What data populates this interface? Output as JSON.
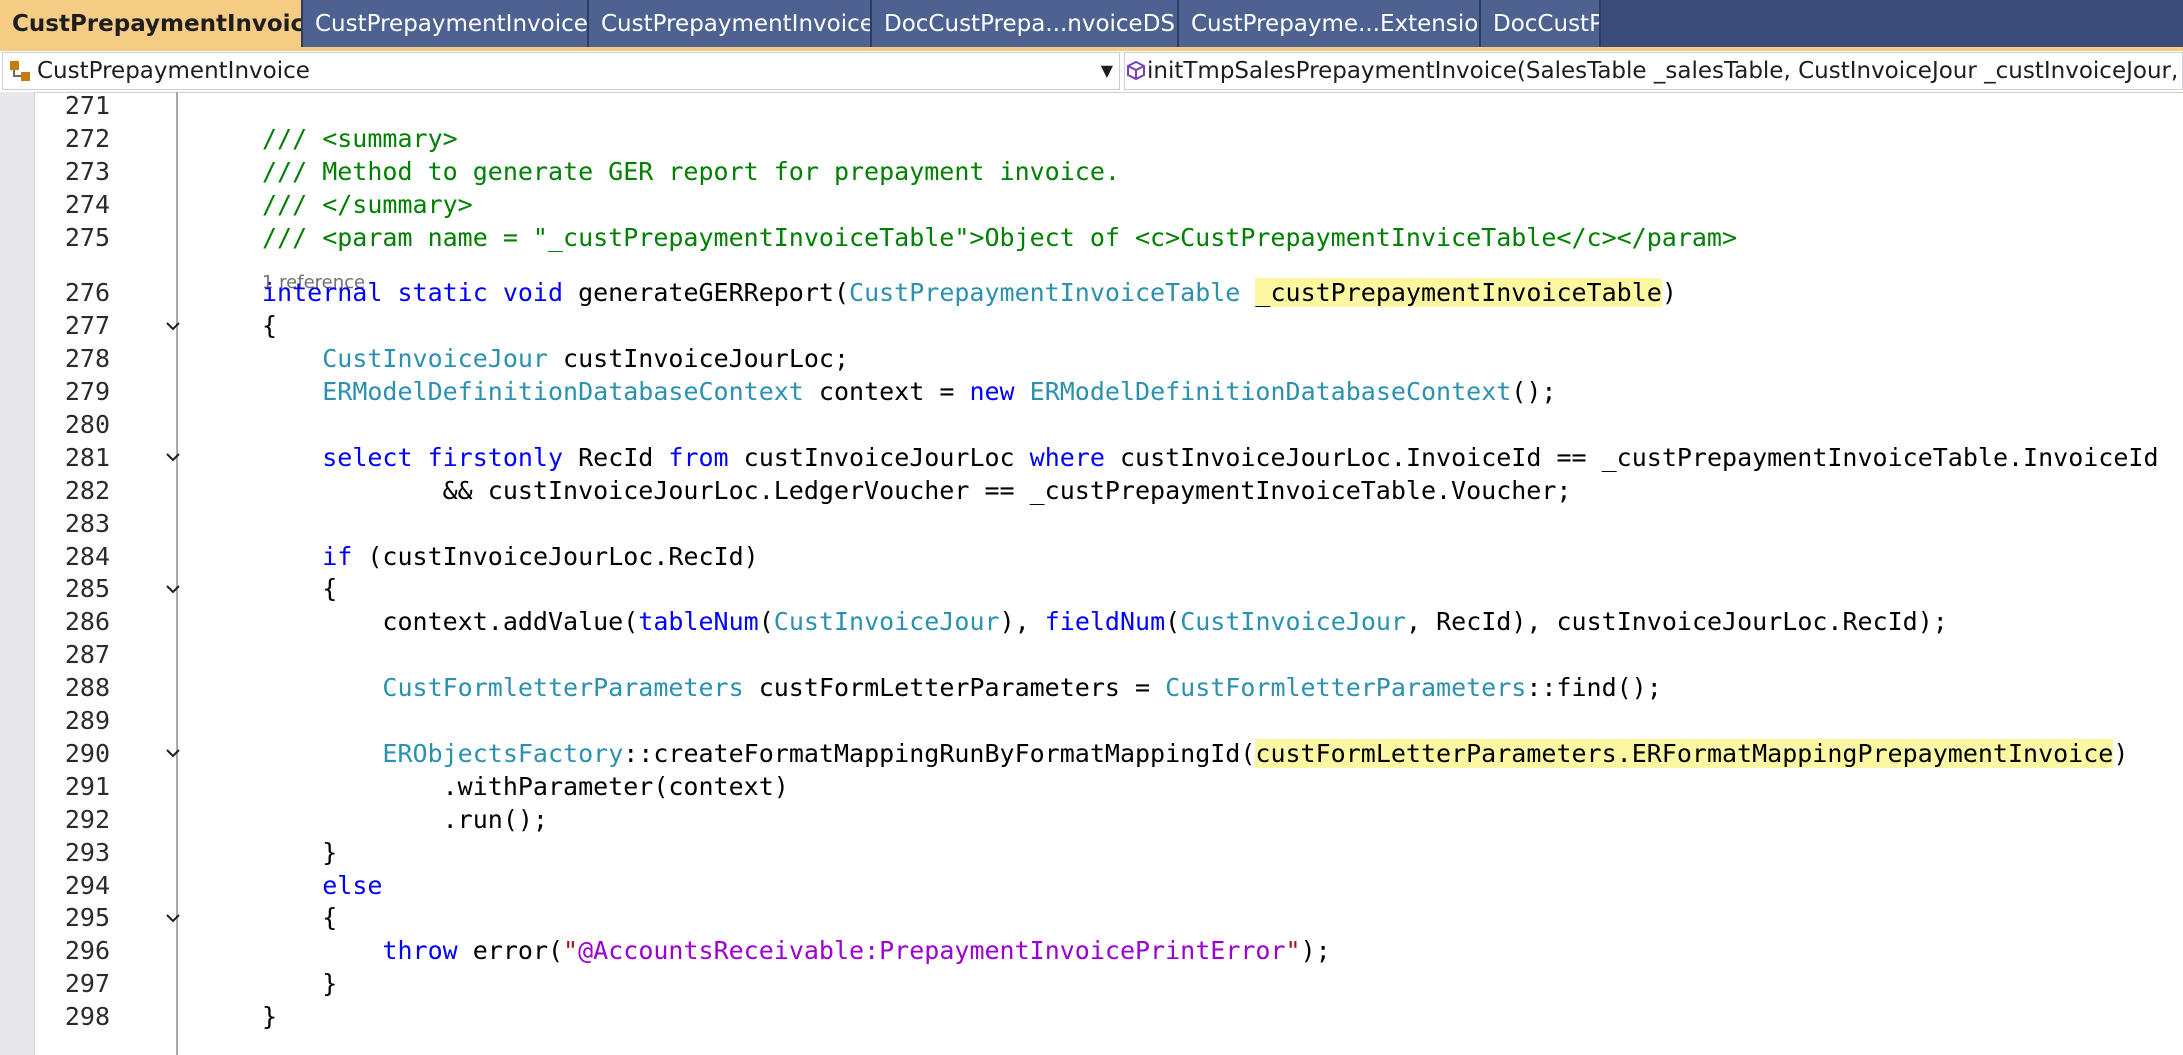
{
  "tabs": [
    {
      "label": "CustPrepaymentInvoice.xpp",
      "active": true
    },
    {
      "label": "CustPrepaymentInvoice.xpp",
      "active": false
    },
    {
      "label": "CustPrepaymentInvoice.xml",
      "active": false
    },
    {
      "label": "DocCustPrepa...nvoiceDSP.xpp",
      "active": false
    },
    {
      "label": "CustPrepayme...Extension_DR",
      "active": false
    },
    {
      "label": "DocCustPre",
      "active": false
    }
  ],
  "tab_pin_glyph": "⊸",
  "tab_close_glyph": "✕",
  "nav": {
    "type_combo_value": "CustPrepaymentInvoice",
    "member_combo_value": "initTmpSalesPrepaymentInvoice(SalesTable _salesTable, CustInvoiceJour _custInvoiceJour, CustPr"
  },
  "codelens": "1 reference",
  "lines": [
    {
      "n": "271",
      "tokens": []
    },
    {
      "n": "272",
      "tokens": [
        [
          "c-comment",
          "/// <summary>"
        ]
      ]
    },
    {
      "n": "273",
      "tokens": [
        [
          "c-comment",
          "/// Method to generate GER report for prepayment invoice."
        ]
      ]
    },
    {
      "n": "274",
      "tokens": [
        [
          "c-comment",
          "/// </summary>"
        ]
      ]
    },
    {
      "n": "275",
      "tokens": [
        [
          "c-comment",
          "/// <param name = \"_custPrepaymentInvoiceTable\">Object of <c>CustPrepaymentInviceTable</c></param>"
        ]
      ]
    },
    {
      "n": "276",
      "tokens": [
        [
          "c-kw",
          "internal static void"
        ],
        [
          "",
          " generateGERReport("
        ],
        [
          "c-type",
          "CustPrepaymentInvoiceTable"
        ],
        [
          "",
          " "
        ],
        [
          "hl",
          "_custPrepaymentInvoiceTable"
        ],
        [
          "",
          ")"
        ]
      ]
    },
    {
      "n": "277",
      "tokens": [
        [
          "",
          "{"
        ]
      ]
    },
    {
      "n": "278",
      "tokens": [
        [
          "",
          "    "
        ],
        [
          "c-type",
          "CustInvoiceJour"
        ],
        [
          "",
          " custInvoiceJourLoc;"
        ]
      ]
    },
    {
      "n": "279",
      "tokens": [
        [
          "",
          "    "
        ],
        [
          "c-type",
          "ERModelDefinitionDatabaseContext"
        ],
        [
          "",
          " context = "
        ],
        [
          "c-kw",
          "new"
        ],
        [
          "",
          " "
        ],
        [
          "c-type",
          "ERModelDefinitionDatabaseContext"
        ],
        [
          "",
          "();"
        ]
      ]
    },
    {
      "n": "280",
      "tokens": []
    },
    {
      "n": "281",
      "tokens": [
        [
          "",
          "    "
        ],
        [
          "c-kw",
          "select firstonly"
        ],
        [
          "",
          " RecId "
        ],
        [
          "c-kw",
          "from"
        ],
        [
          "",
          " custInvoiceJourLoc "
        ],
        [
          "c-kw",
          "where"
        ],
        [
          "",
          " custInvoiceJourLoc.InvoiceId == _custPrepaymentInvoiceTable.InvoiceId"
        ]
      ]
    },
    {
      "n": "282",
      "tokens": [
        [
          "",
          "            && custInvoiceJourLoc.LedgerVoucher == _custPrepaymentInvoiceTable.Voucher;"
        ]
      ]
    },
    {
      "n": "283",
      "tokens": []
    },
    {
      "n": "284",
      "tokens": [
        [
          "",
          "    "
        ],
        [
          "c-kw",
          "if"
        ],
        [
          "",
          " (custInvoiceJourLoc.RecId)"
        ]
      ]
    },
    {
      "n": "285",
      "tokens": [
        [
          "",
          "    {"
        ]
      ]
    },
    {
      "n": "286",
      "tokens": [
        [
          "",
          "        context.addValue("
        ],
        [
          "c-kw",
          "tableNum"
        ],
        [
          "",
          "("
        ],
        [
          "c-type",
          "CustInvoiceJour"
        ],
        [
          "",
          "), "
        ],
        [
          "c-kw",
          "fieldNum"
        ],
        [
          "",
          "("
        ],
        [
          "c-type",
          "CustInvoiceJour"
        ],
        [
          "",
          ", RecId), custInvoiceJourLoc.RecId);"
        ]
      ]
    },
    {
      "n": "287",
      "tokens": []
    },
    {
      "n": "288",
      "tokens": [
        [
          "",
          "        "
        ],
        [
          "c-type",
          "CustFormletterParameters"
        ],
        [
          "",
          " custFormLetterParameters = "
        ],
        [
          "c-type",
          "CustFormletterParameters"
        ],
        [
          "",
          "::find();"
        ]
      ]
    },
    {
      "n": "289",
      "tokens": []
    },
    {
      "n": "290",
      "tokens": [
        [
          "",
          "        "
        ],
        [
          "c-type",
          "ERObjectsFactory"
        ],
        [
          "",
          "::createFormatMappingRunByFormatMappingId("
        ],
        [
          "hl",
          "custFormLetterParameters.ERFormatMappingPrepaymentInvoice"
        ],
        [
          "",
          ")"
        ]
      ]
    },
    {
      "n": "291",
      "tokens": [
        [
          "",
          "            .withParameter(context)"
        ]
      ]
    },
    {
      "n": "292",
      "tokens": [
        [
          "",
          "            .run();"
        ]
      ]
    },
    {
      "n": "293",
      "tokens": [
        [
          "",
          "    }"
        ]
      ]
    },
    {
      "n": "294",
      "tokens": [
        [
          "",
          "    "
        ],
        [
          "c-kw",
          "else"
        ]
      ]
    },
    {
      "n": "295",
      "tokens": [
        [
          "",
          "    {"
        ]
      ]
    },
    {
      "n": "296",
      "tokens": [
        [
          "",
          "        "
        ],
        [
          "c-kw",
          "throw"
        ],
        [
          "",
          " error("
        ],
        [
          "c-str",
          "\""
        ],
        [
          "c-label",
          "@AccountsReceivable:PrepaymentInvoicePrintError"
        ],
        [
          "c-str",
          "\""
        ],
        [
          "",
          ");"
        ]
      ]
    },
    {
      "n": "297",
      "tokens": [
        [
          "",
          "    }"
        ]
      ]
    },
    {
      "n": "298",
      "tokens": [
        [
          "",
          "}"
        ]
      ]
    }
  ],
  "folds": [
    "277",
    "281",
    "285",
    "290",
    "295"
  ],
  "colors": {
    "tab_bg": "#3b4c7a",
    "tab_active_bg": "#f5cc84",
    "keyword": "#0000ff",
    "type": "#2b91af",
    "comment": "#008000",
    "label": "#9b00d3",
    "highlight": "#fcf8a2"
  }
}
